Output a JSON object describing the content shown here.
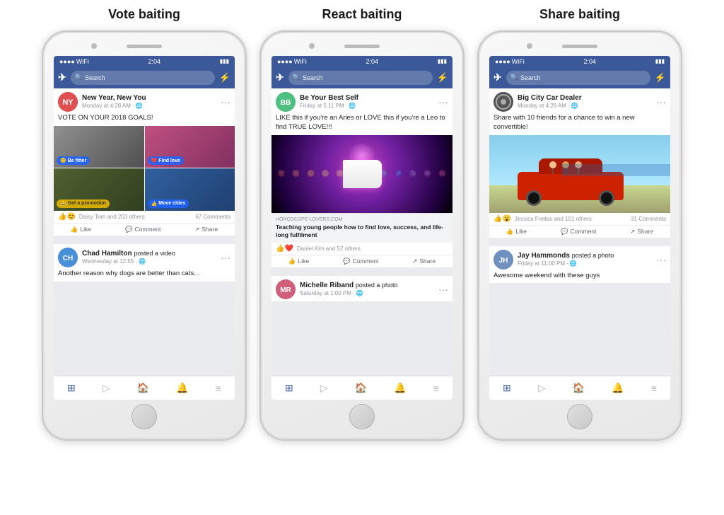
{
  "titles": {
    "vote_baiting": "Vote baiting",
    "react_baiting": "React baiting",
    "share_baiting": "Share baiting"
  },
  "status_bar": {
    "time": "2:04",
    "signal": "●●●●",
    "wifi": "WiFi",
    "battery": "■■■"
  },
  "nav": {
    "search_placeholder": "Search",
    "logo": "✈",
    "messenger": "⚡"
  },
  "phone1": {
    "post1": {
      "author": "New Year, New You",
      "time": "Monday at 4:28 AM",
      "privacy": "🌐",
      "text": "VOTE ON YOUR 2018 GOALS!",
      "labels": {
        "tl": "Be fitter",
        "tr": "Find love",
        "bl": "Get a promotion",
        "br": "Move cities"
      },
      "reactions": "Daisy Tam and 203 others",
      "comments": "67 Comments",
      "like": "Like",
      "comment": "Comment",
      "share": "Share"
    },
    "post2": {
      "author": "Chad Hamilton",
      "action": "posted a video",
      "time": "Wednesday at 12:55",
      "privacy": "🌐",
      "text": "Another reason why dogs are better than cats..."
    }
  },
  "phone2": {
    "post1": {
      "author": "Be Your Best Self",
      "time": "Friday at 5:11 PM",
      "privacy": "🌐",
      "text": "LIKE this if you're an Aries or LOVE this if you're a Leo to find TRUE LOVE!!!",
      "link_source": "HOROSCOPE-LOVERS.COM",
      "link_title": "Teaching young people how to find love, success, and life-long fulfilment",
      "reactions": "Daniel Kim and 52 others",
      "like": "Like",
      "comment": "Comment",
      "share": "Share"
    },
    "post2": {
      "author": "Michelle Riband",
      "action": "posted a photo",
      "time": "Saturday at 1:00 PM",
      "privacy": "🌐"
    }
  },
  "phone3": {
    "post1": {
      "author": "Big City Car Dealer",
      "time": "Monday at 4:28 AM",
      "privacy": "🌐",
      "text": "Share with 10 friends for a chance to win a new convertible!",
      "reactions": "Jessica Freitas and 101 others",
      "comments": "31 Comments",
      "like": "Like",
      "comment": "Comment",
      "share": "Share"
    },
    "post2": {
      "author": "Jay Hammonds",
      "action": "posted a photo",
      "time": "Friday at 11:00 PM",
      "privacy": "🌐",
      "text": "Awesome weekend with these guys"
    }
  },
  "bottom_nav": {
    "home": "⊞",
    "video": "▷",
    "marketplace": "🏠",
    "notifications": "🔔",
    "menu": "≡"
  }
}
